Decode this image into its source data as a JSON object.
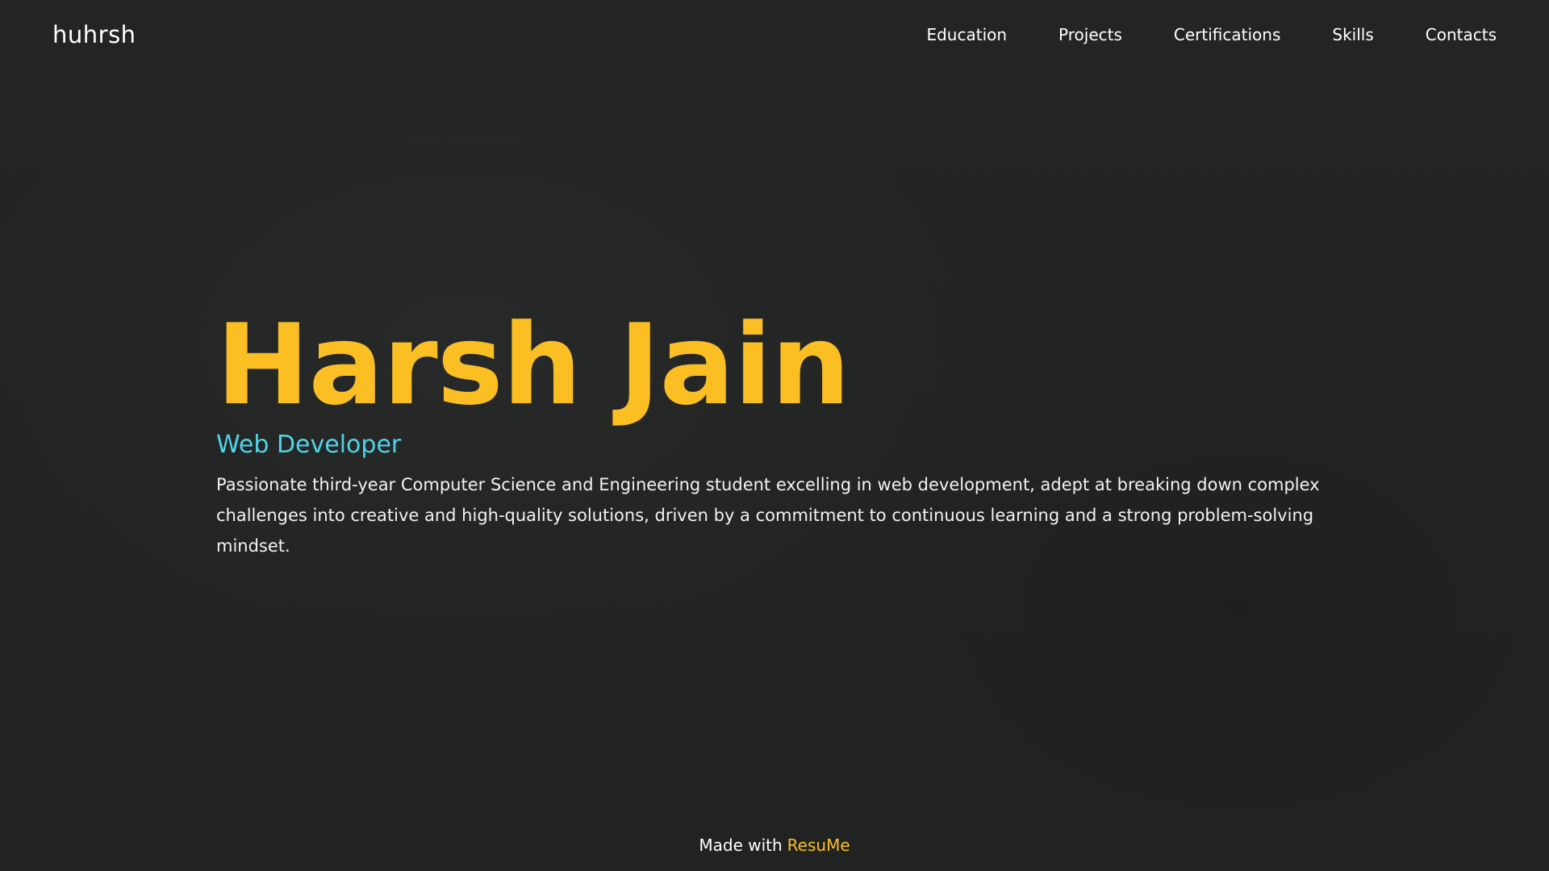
{
  "header": {
    "brand": "huhrsh",
    "nav": [
      {
        "label": "Education"
      },
      {
        "label": "Projects"
      },
      {
        "label": "Certifications"
      },
      {
        "label": "Skills"
      },
      {
        "label": "Contacts"
      }
    ]
  },
  "hero": {
    "name": "Harsh Jain",
    "role": "Web Developer",
    "bio": "Passionate third-year Computer Science and Engineering student excelling in web development, adept at breaking down complex challenges into creative and high-quality solutions, driven by a commitment to continuous learning and a strong problem-solving mindset."
  },
  "footer": {
    "made_with": "Made with",
    "brand": "ResuMe"
  },
  "colors": {
    "background": "#222423",
    "accent_yellow": "#fbbf24",
    "accent_cyan": "#4fd3e8",
    "text": "#ffffff"
  }
}
